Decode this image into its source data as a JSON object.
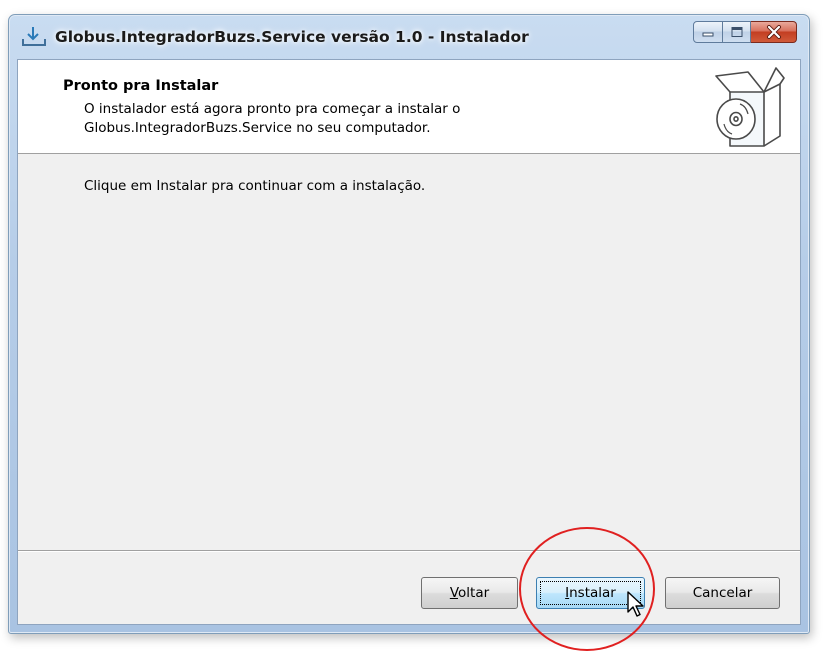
{
  "window": {
    "title": "Globus.IntegradorBuzs.Service versão 1.0 - Instalador",
    "controls": [
      "minimize-icon",
      "maximize-icon",
      "close-icon"
    ]
  },
  "header": {
    "title": "Pronto pra Instalar",
    "description_line1": "O instalador está agora pronto pra começar a instalar o",
    "description_line2": "Globus.IntegradorBuzs.Service no seu computador.",
    "icon": "install-box-cd-icon"
  },
  "body": {
    "text": "Clique em Instalar pra continuar com a instalação."
  },
  "buttons": {
    "back_first": "V",
    "back_rest": "oltar",
    "install_first": "I",
    "install_rest": "nstalar",
    "cancel_label": "Cancelar"
  },
  "colors": {
    "highlight_circle": "#e02020",
    "primary_button": "#bee6fd"
  }
}
